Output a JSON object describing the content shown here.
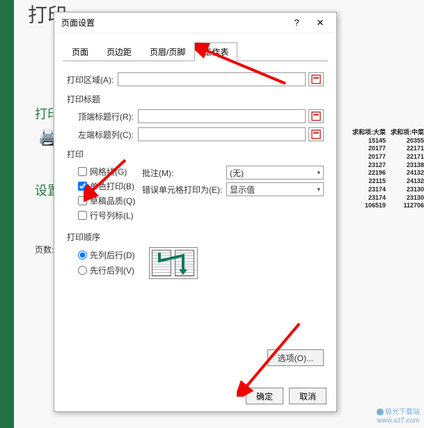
{
  "background": {
    "title": "打印",
    "leftLabel1": "打印",
    "leftLabel2": "设置",
    "pagesLabel": "页数:",
    "dataHeader1": "求和项:大菜",
    "dataHeader2": "求和项:中菜",
    "dataRows": [
      [
        "15145",
        "20355"
      ],
      [
        "20177",
        "22171"
      ],
      [
        "20177",
        "22171"
      ],
      [
        "23127",
        "23138"
      ],
      [
        "22196",
        "24132"
      ],
      [
        "22115",
        "24132"
      ],
      [
        "23174",
        "23130"
      ],
      [
        "23174",
        "23130"
      ],
      [
        "106519",
        "112706"
      ]
    ]
  },
  "dialog": {
    "title": "页面设置",
    "help": "?",
    "close": "✕",
    "tabs": {
      "page": "页面",
      "margins": "页边距",
      "headerFooter": "页眉/页脚",
      "sheet": "工作表"
    },
    "printArea": {
      "label": "打印区域(A):"
    },
    "printTitlesHeader": "打印标题",
    "topRow": {
      "label": "顶端标题行(R):"
    },
    "leftCol": {
      "label": "左端标题列(C):"
    },
    "printHeader": "打印",
    "checks": {
      "gridlines": "网格线(G)",
      "bw": "单色打印(B)",
      "draft": "草稿品质(Q)",
      "rowcol": "行号列标(L)"
    },
    "comments": {
      "label": "批注(M):",
      "value": "(无)"
    },
    "errors": {
      "label": "错误单元格打印为(E):",
      "value": "显示值"
    },
    "orderHeader": "打印顺序",
    "order": {
      "downOver": "先列后行(D)",
      "overDown": "先行后列(V)"
    },
    "optionsBtn": "选项(O)...",
    "ok": "确定",
    "cancel": "取消"
  },
  "watermark": {
    "line1": "极光下载站",
    "line2": "www.xz7.com"
  }
}
